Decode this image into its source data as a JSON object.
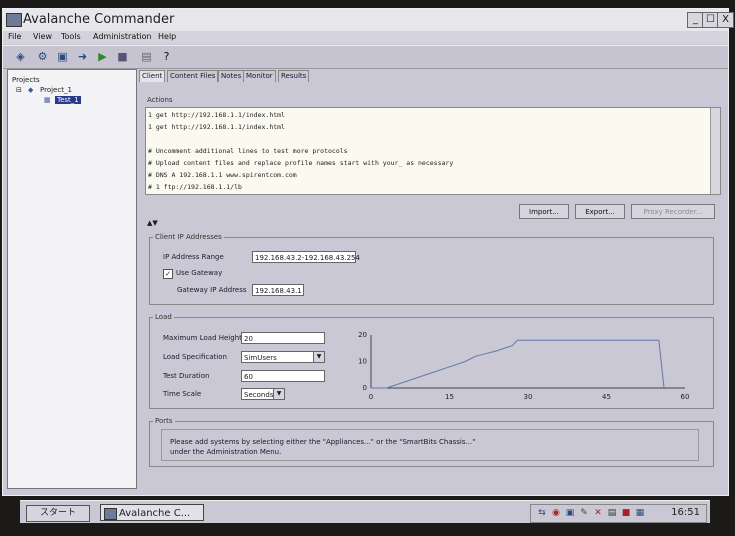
{
  "window": {
    "title": "Avalanche Commander",
    "controls": [
      "_",
      "☐",
      "X"
    ]
  },
  "menu": [
    "File",
    "View",
    "Tools",
    "Administration",
    "Help"
  ],
  "toolbar_icons": [
    "network-icon",
    "gear-icon",
    "save-icon",
    "arrow-icon",
    "play-icon",
    "stop-icon",
    "file-icon",
    "help-icon"
  ],
  "tree": {
    "root": "Projects",
    "project": "Project_1",
    "test": "Test_1"
  },
  "tabs": [
    "Client",
    "Content Files",
    "Notes",
    "Monitor",
    "Results"
  ],
  "actions": {
    "label": "Actions",
    "lines": [
      "1 get http://192.168.1.1/index.html",
      "1 get http://192.168.1.1/index.html",
      "",
      "# Uncomment additional lines to test more protocols",
      "# Upload content files and replace profile names start with your_ as necessary",
      "# DNS A  192.168.1.1 www.spirentcom.com",
      "# 1 ftp://192.168.1.1/lb"
    ],
    "buttons": {
      "import": "Import...",
      "export": "Export...",
      "proxy": "Proxy Recorder..."
    }
  },
  "client_ip": {
    "label": "Client IP Addresses",
    "range_label": "IP Address Range",
    "range_value": "192.168.43.2-192.168.43.254",
    "use_gateway_label": "Use Gateway",
    "use_gateway_checked": "✓",
    "gateway_label": "Gateway IP Address",
    "gateway_value": "192.168.43.1"
  },
  "load": {
    "label": "Load",
    "max_height_label": "Maximum Load Height",
    "max_height_value": "20",
    "spec_label": "Load Specification",
    "spec_value": "SimUsers",
    "duration_label": "Test Duration",
    "duration_value": "60",
    "timescale_label": "Time Scale",
    "timescale_value": "Seconds"
  },
  "chart_data": {
    "type": "line",
    "x": [
      0,
      3,
      9,
      12,
      15,
      18,
      20,
      22,
      24,
      27,
      28,
      55,
      56
    ],
    "y": [
      0,
      0,
      4,
      6,
      8,
      10,
      12,
      13,
      14,
      16,
      18,
      18,
      0
    ],
    "xticks": [
      "0",
      "15",
      "30",
      "45",
      "60"
    ],
    "yticks": [
      "0",
      "10",
      "20"
    ],
    "xlim": [
      0,
      60
    ],
    "ylim": [
      0,
      20
    ],
    "line_color": "#6677aa"
  },
  "ports": {
    "label": "Ports",
    "message_line1": "Please add systems by selecting either the \"Appliances...\" or the \"SmartBits Chassis...\"",
    "message_line2": "under the Administration Menu."
  },
  "taskbar": {
    "start": "スタート",
    "task": "Avalanche C...",
    "clock": "16:51"
  }
}
